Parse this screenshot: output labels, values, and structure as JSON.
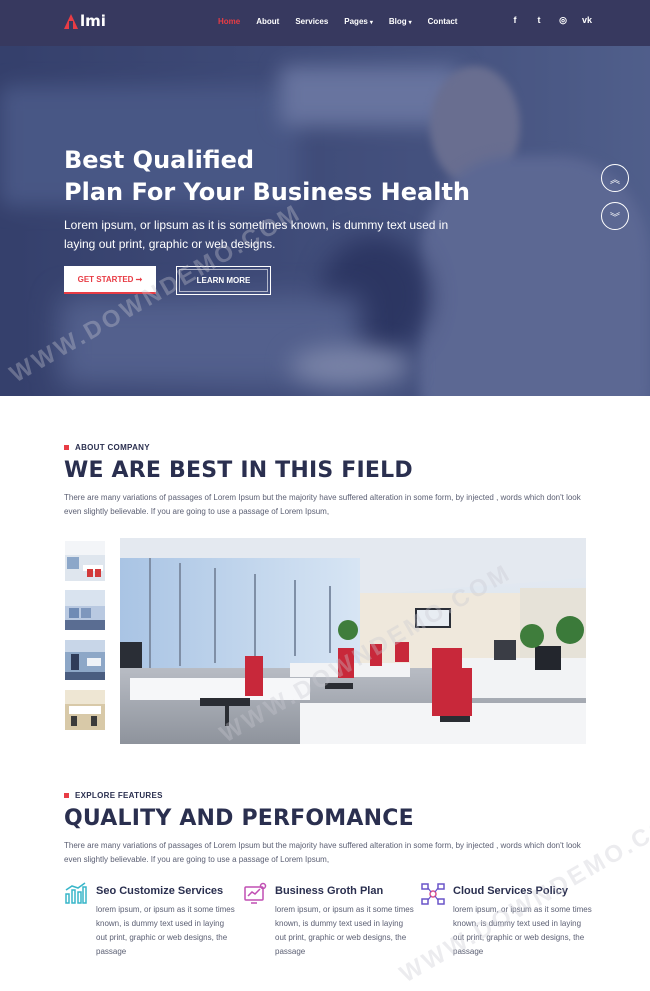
{
  "brand": {
    "logo_text": "lmi",
    "accent": "#e83c45",
    "nav_bg": "#37395f"
  },
  "nav": {
    "items": [
      {
        "label": "Home",
        "active": true
      },
      {
        "label": "About"
      },
      {
        "label": "Services"
      },
      {
        "label": "Pages",
        "dropdown": true
      },
      {
        "label": "Blog",
        "dropdown": true
      },
      {
        "label": "Contact"
      }
    ],
    "social": [
      "facebook-icon",
      "twitter-icon",
      "instagram-icon",
      "vk-icon"
    ],
    "social_glyphs": [
      "f",
      "t",
      "◎",
      "vk"
    ]
  },
  "hero": {
    "title_line1": "Best Qualified",
    "title_line2": "Plan For Your Business Health",
    "text": "Lorem ipsum, or lipsum as it is sometimes known, is dummy text used in laying out print, graphic or web designs.",
    "primary_button": "GET STARTED ➞",
    "secondary_button": "LEARN MORE",
    "slide_up": "︽",
    "slide_down": "︾"
  },
  "about": {
    "kicker": "ABOUT COMPANY",
    "title": "WE ARE BEST IN THIS FIELD",
    "text": "There are many variations of passages of Lorem Ipsum but the majority have suffered alteration in some form, by injected , words which don't look even slightly believable. If you are going to use a passage of Lorem Ipsum,"
  },
  "features": {
    "kicker": "EXPLORE FEATURES",
    "title": "QUALITY AND PERFOMANCE",
    "text": "There are many variations of passages of Lorem Ipsum but the majority have suffered alteration in some form, by injected , words which don't look even slightly believable. If you are going to use a passage of Lorem Ipsum,",
    "items": [
      {
        "icon": "seo-chart-icon",
        "title": "Seo Customize Services",
        "text": "lorem ipsum, or ipsum as it some times known, is dummy text used in laying out print, graphic or web designs, the passage"
      },
      {
        "icon": "business-growth-icon",
        "title": "Business Groth Plan",
        "text": "lorem ipsum, or ipsum as it some times known, is dummy text used in laying out print, graphic or web designs, the passage"
      },
      {
        "icon": "cloud-network-icon",
        "title": "Cloud Services Policy",
        "text": "lorem ipsum, or ipsum as it some times known, is dummy text used in laying out print, graphic or web designs, the passage"
      }
    ]
  },
  "watermark": "WWW.DOWNDEMO.COM"
}
